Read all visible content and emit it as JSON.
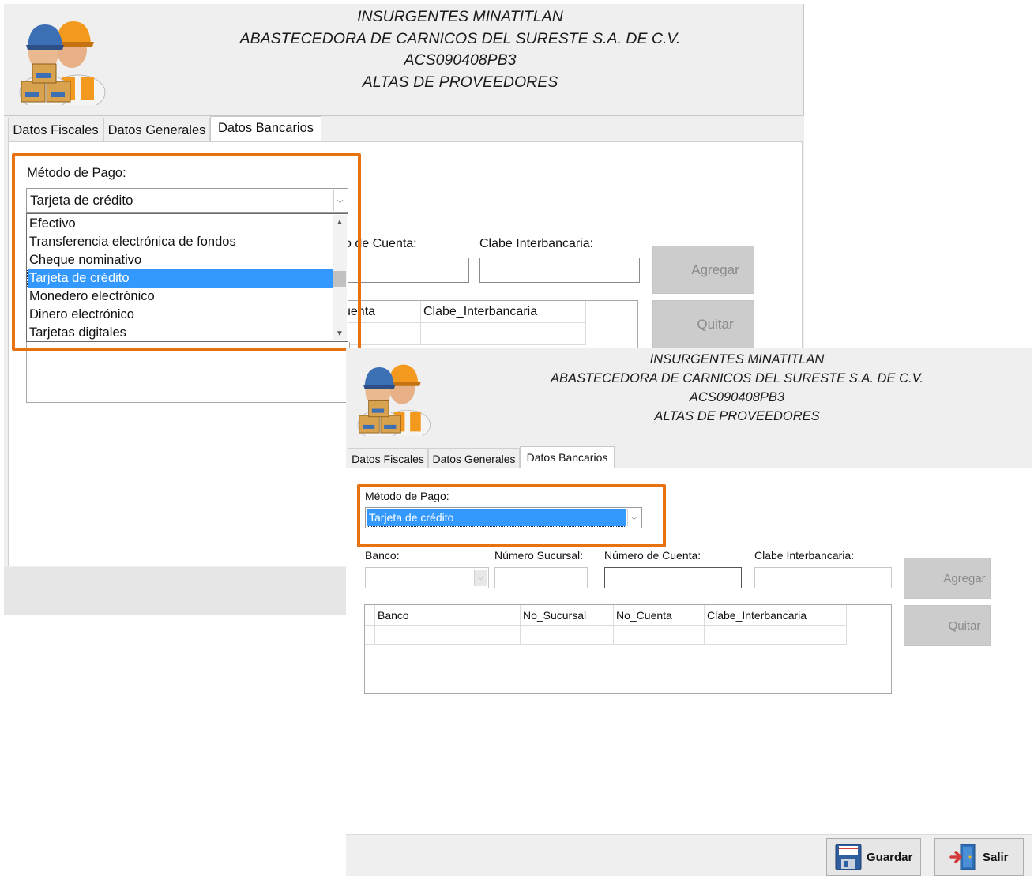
{
  "header": {
    "line1": "INSURGENTES MINATITLAN",
    "line2": "ABASTECEDORA DE CARNICOS DEL SURESTE S.A. DE C.V.",
    "line3": "ACS090408PB3",
    "line4": "ALTAS DE PROVEEDORES",
    "logo_icon": "workers-with-boxes-icon"
  },
  "tabs": [
    "Datos Fiscales",
    "Datos Generales",
    "Datos Bancarios"
  ],
  "active_tab": "Datos Bancarios",
  "metodo_pago": {
    "label": "Método de Pago:",
    "selected": "Tarjeta de crédito",
    "options": [
      "Efectivo",
      "Transferencia electrónica de fondos",
      "Cheque nominativo",
      "Tarjeta de crédito",
      "Monedero electrónico",
      "Dinero electrónico",
      "Tarjetas digitales"
    ]
  },
  "window1_partial_labels": {
    "numero_cuenta_fragment": "o de Cuenta:",
    "grid_fragment": "uenta"
  },
  "fields": {
    "banco": "Banco:",
    "numero_sucursal": "Número Sucursal:",
    "numero_cuenta": "Número de Cuenta:",
    "clabe": "Clabe Interbancaria:"
  },
  "buttons": {
    "agregar": "Agregar",
    "quitar": "Quitar",
    "guardar": "Guardar",
    "salir": "Salir"
  },
  "grid": {
    "columns": [
      "Banco",
      "No_Sucursal",
      "No_Cuenta",
      "Clabe_Interbancaria"
    ]
  },
  "colors": {
    "highlight": "#e87211",
    "selection": "#3399ff",
    "disabled_button": "#cccccc"
  }
}
